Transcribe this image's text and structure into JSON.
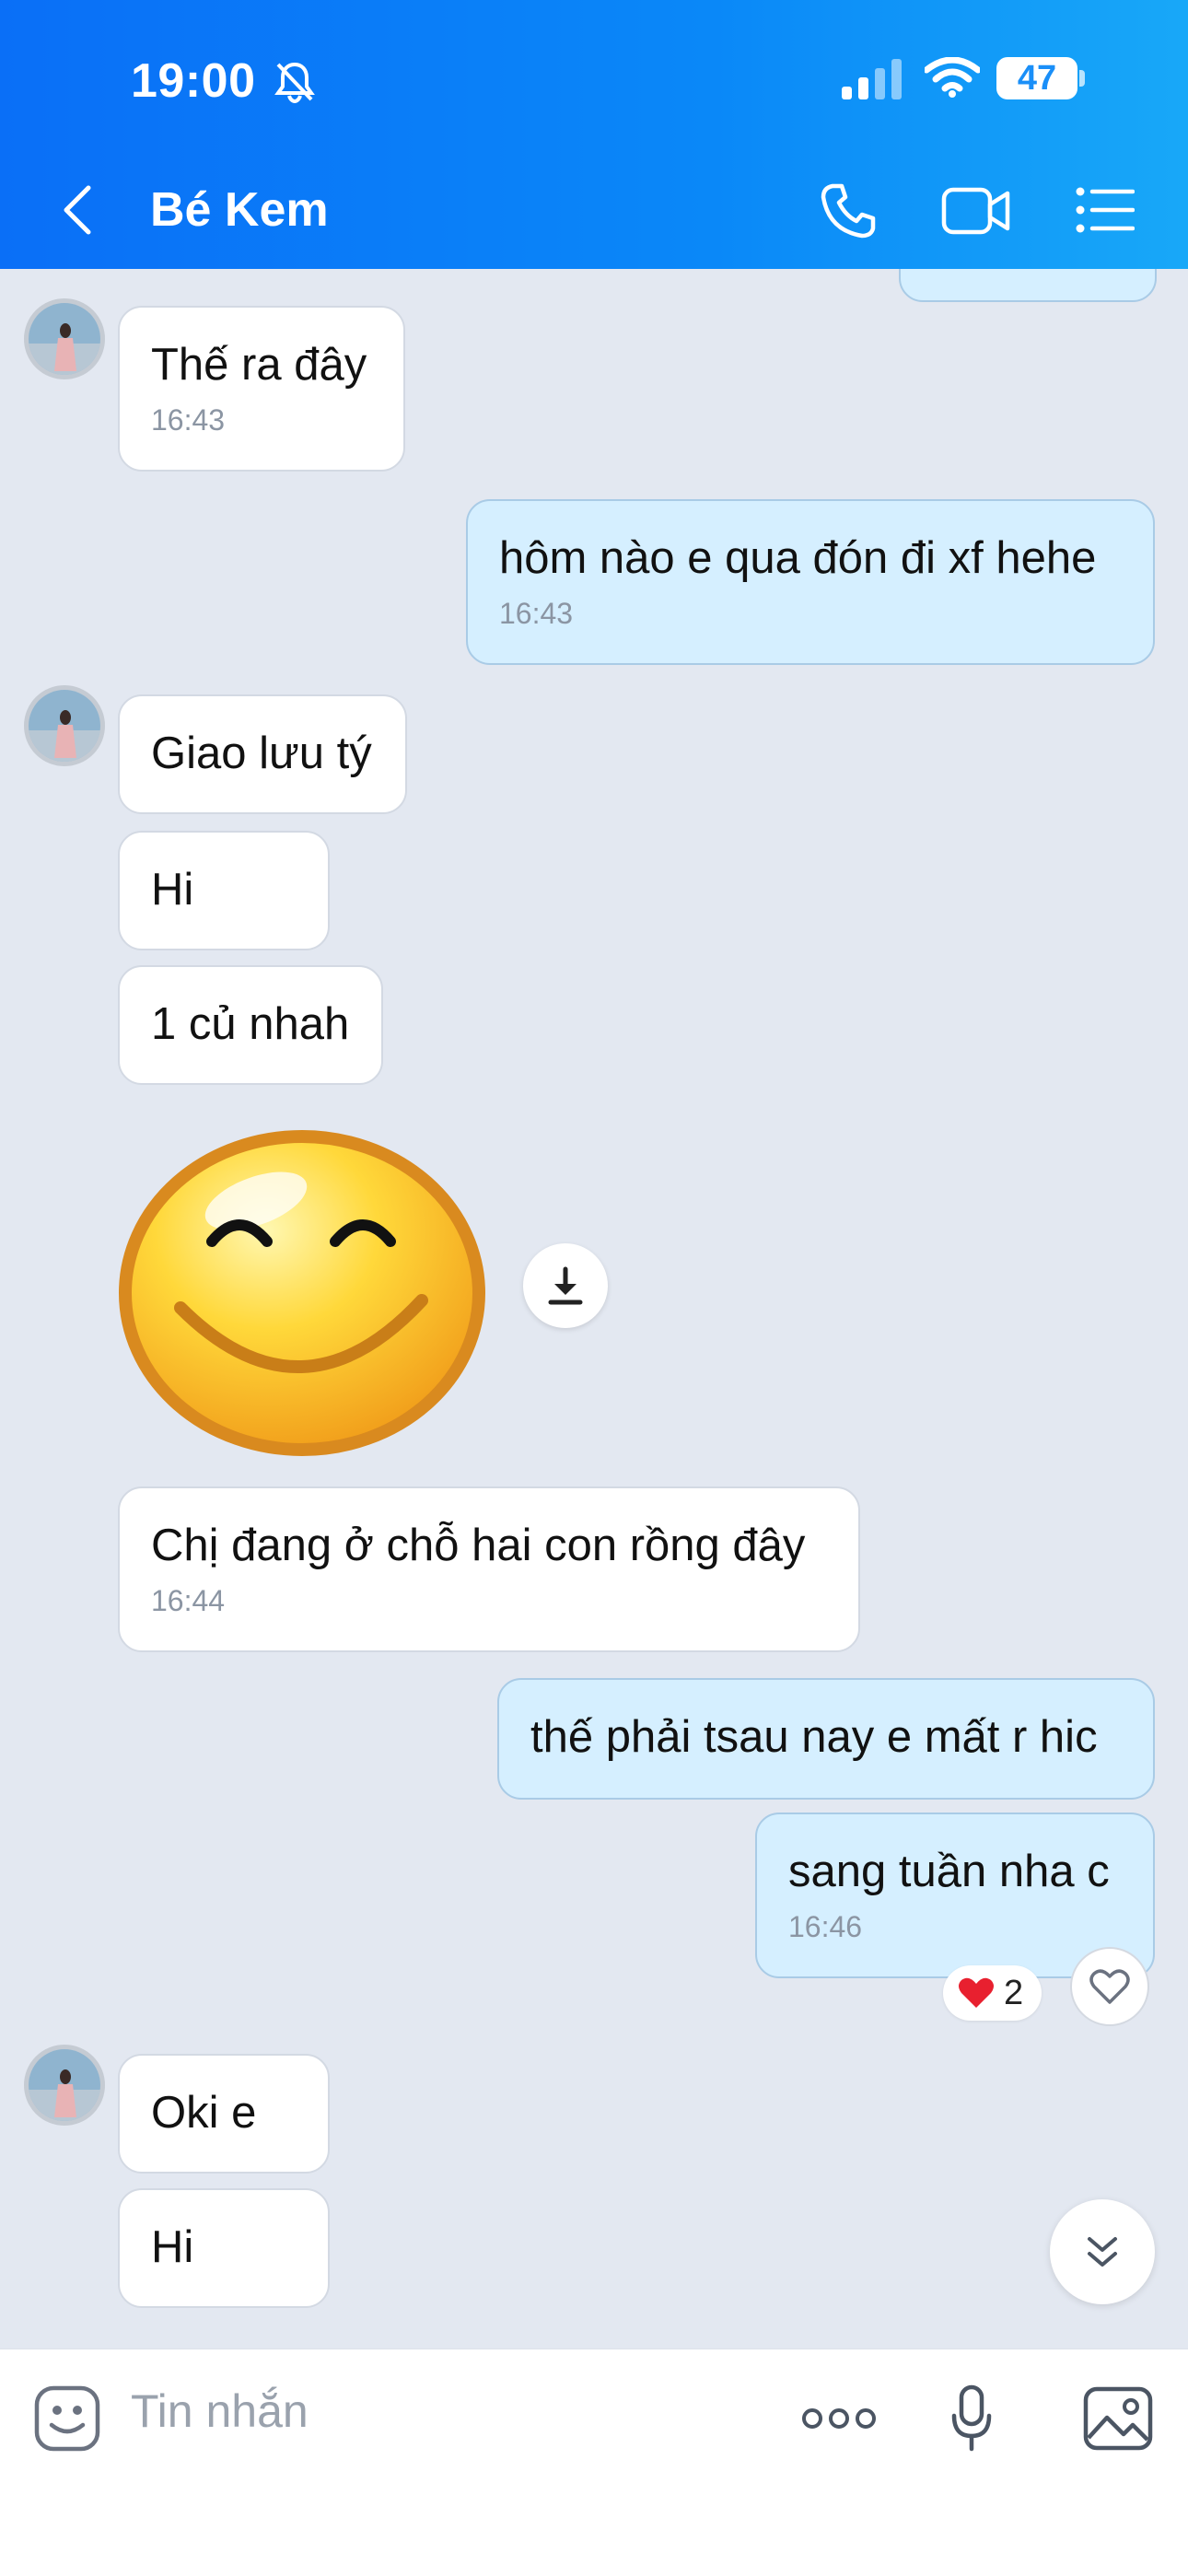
{
  "status_bar": {
    "time": "19:00",
    "battery": "47"
  },
  "header": {
    "title": "Bé Kem"
  },
  "messages": [
    {
      "text": "Thế ra đây",
      "time": "16:43"
    },
    {
      "text": "hôm nào e qua đón đi xf hehe",
      "time": "16:43"
    },
    {
      "text": "Giao lưu tý"
    },
    {
      "text": "Hi"
    },
    {
      "text": "1 củ nhah"
    },
    {
      "text": "Chị đang ở chỗ hai con rồng đây",
      "time": "16:44"
    },
    {
      "text": "thế phải tsau nay e mất r hic"
    },
    {
      "text": "sang tuần nha c",
      "time": "16:46"
    },
    {
      "text": "Oki e"
    },
    {
      "text": "Hi"
    }
  ],
  "reaction": {
    "count": "2"
  },
  "composer": {
    "placeholder": "Tin nhắn"
  },
  "colors": {
    "header": "#0a88f8",
    "outgoing": "#d5efff",
    "incoming": "#ffffff",
    "background": "#e3e8f1"
  }
}
